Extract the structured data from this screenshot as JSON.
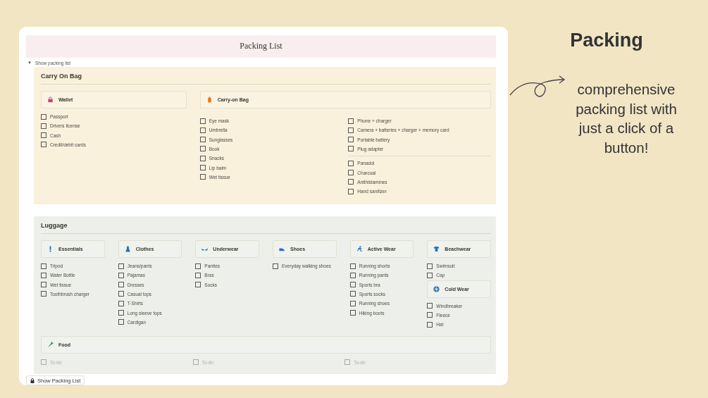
{
  "page_title": "Packing List",
  "toggle": {
    "arrow": "▼",
    "label": "Show packing list",
    "expanded": true
  },
  "sections": [
    {
      "title": "Carry On Bag",
      "kind": "yellow",
      "rows": [
        [
          {
            "cards": [
              {
                "title": "Wallet",
                "kind": "lock",
                "columns": [
                  [
                    [
                      {
                        "label": "Passport",
                        "checked": false
                      },
                      {
                        "label": "Drivers license",
                        "checked": false
                      },
                      {
                        "label": "Cash",
                        "checked": false
                      },
                      {
                        "label": "Credit/debit cards",
                        "checked": false
                      }
                    ]
                  ]
                ]
              }
            ]
          },
          {
            "cards": [
              {
                "title": "Carry-on Bag",
                "kind": "bag",
                "columns": [
                  [
                    [
                      {
                        "label": "Eye mask",
                        "checked": false
                      },
                      {
                        "label": "Umbrella",
                        "checked": false
                      },
                      {
                        "label": "Sunglasses",
                        "checked": false
                      },
                      {
                        "label": "Book",
                        "checked": false
                      },
                      {
                        "label": "Snacks",
                        "checked": false
                      },
                      {
                        "label": "Lip balm",
                        "checked": false
                      },
                      {
                        "label": "Wet tissue",
                        "checked": false
                      }
                    ]
                  ],
                  [
                    [
                      {
                        "label": "Phone + charger",
                        "checked": false
                      },
                      {
                        "label": "Camera + batteries + charger + memory card",
                        "checked": false
                      },
                      {
                        "label": "Portable battery",
                        "checked": false
                      },
                      {
                        "label": "Plug adapter",
                        "checked": false
                      }
                    ],
                    [
                      {
                        "label": "Panadol",
                        "checked": false
                      },
                      {
                        "label": "Charcoal",
                        "checked": false
                      },
                      {
                        "label": "Antihistamines",
                        "checked": false
                      },
                      {
                        "label": "Hand sanitizer",
                        "checked": false
                      }
                    ]
                  ]
                ]
              }
            ]
          }
        ]
      ]
    },
    {
      "title": "Luggage",
      "kind": "green",
      "rows": [
        [
          {
            "cards": [
              {
                "title": "Essentials",
                "kind": "exclamation",
                "columns": [
                  [
                    [
                      {
                        "label": "Tripod",
                        "checked": false
                      },
                      {
                        "label": "Water Bottle",
                        "checked": false
                      },
                      {
                        "label": "Wet tissue",
                        "checked": false
                      },
                      {
                        "label": "Toothbrush charger",
                        "checked": false
                      }
                    ]
                  ]
                ]
              }
            ]
          },
          {
            "cards": [
              {
                "title": "Clothes",
                "kind": "dress",
                "columns": [
                  [
                    [
                      {
                        "label": "Jeans/pants",
                        "checked": false
                      },
                      {
                        "label": "Pajamas",
                        "checked": false
                      },
                      {
                        "label": "Dresses",
                        "checked": false
                      },
                      {
                        "label": "Casual tops",
                        "checked": false
                      },
                      {
                        "label": "T-Shirts",
                        "checked": false
                      },
                      {
                        "label": "Long sleeve tops",
                        "checked": false
                      },
                      {
                        "label": "Cardigan",
                        "checked": false
                      }
                    ]
                  ]
                ]
              }
            ]
          },
          {
            "cards": [
              {
                "title": "Underwear",
                "kind": "bra",
                "columns": [
                  [
                    [
                      {
                        "label": "Panties",
                        "checked": false
                      },
                      {
                        "label": "Bras",
                        "checked": false
                      },
                      {
                        "label": "Socks",
                        "checked": false
                      }
                    ]
                  ]
                ]
              }
            ]
          },
          {
            "cards": [
              {
                "title": "Shoes",
                "kind": "shoe",
                "columns": [
                  [
                    [
                      {
                        "label": "Everyday walking shoes",
                        "checked": false
                      }
                    ]
                  ]
                ]
              }
            ]
          },
          {
            "cards": [
              {
                "title": "Active Wear",
                "kind": "runner",
                "columns": [
                  [
                    [
                      {
                        "label": "Running shorts",
                        "checked": false
                      },
                      {
                        "label": "Running pants",
                        "checked": false
                      },
                      {
                        "label": "Sports bra",
                        "checked": false
                      },
                      {
                        "label": "Sports socks",
                        "checked": false
                      },
                      {
                        "label": "Running shoes",
                        "checked": false
                      },
                      {
                        "label": "Hiking boots",
                        "checked": false
                      }
                    ]
                  ]
                ]
              }
            ]
          },
          {
            "cards": [
              {
                "title": "Beachwear",
                "kind": "shirt",
                "columns": [
                  [
                    [
                      {
                        "label": "Swimsuit",
                        "checked": false
                      },
                      {
                        "label": "Cap",
                        "checked": false
                      }
                    ]
                  ]
                ]
              },
              {
                "title": "Cold Wear",
                "kind": "snowflake",
                "columns": [
                  [
                    [
                      {
                        "label": "Windbreaker",
                        "checked": false
                      },
                      {
                        "label": "Fleece",
                        "checked": false
                      },
                      {
                        "label": "Hat",
                        "checked": false
                      }
                    ]
                  ]
                ]
              }
            ]
          }
        ],
        [
          {
            "cards": [
              {
                "title": "Food",
                "kind": "carrot",
                "columns": [
                  [
                    [
                      {
                        "placeholder": "To-do",
                        "checked": false
                      }
                    ]
                  ],
                  [
                    [
                      {
                        "placeholder": "To-do",
                        "checked": false
                      }
                    ]
                  ],
                  [
                    [
                      {
                        "placeholder": "To-do",
                        "checked": false
                      }
                    ]
                  ]
                ]
              }
            ]
          }
        ]
      ]
    }
  ],
  "footer_button": {
    "label": "Show Packing List"
  },
  "side": {
    "heading": "Packing",
    "text": "comprehensive packing list with just a click of a button!"
  }
}
